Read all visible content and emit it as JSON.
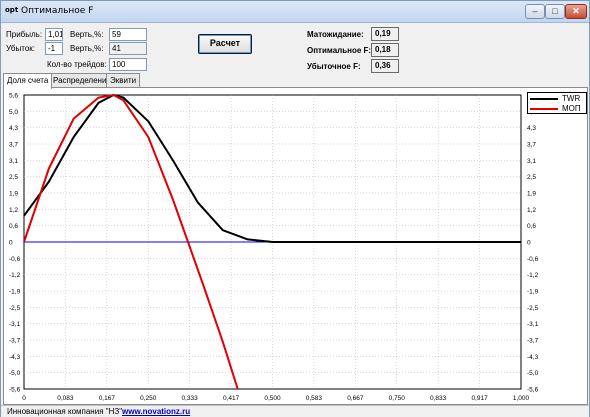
{
  "window": {
    "title": "Оптимальное F",
    "app_icon": "opt"
  },
  "inputs": {
    "profit_label": "Прибыль:",
    "profit_value": "1,01",
    "loss_label": "Убыток:",
    "loss_value": "-1",
    "prob1_label": "Верть,%:",
    "prob1_value": "59",
    "prob2_label": "Верть,%:",
    "prob2_value": "41",
    "trades_label": "Кол-во трейдов:",
    "trades_value": "100"
  },
  "calc_button": "Расчет",
  "results": {
    "expectation_label": "Матожидание:",
    "expectation_value": "0,19",
    "optimal_label": "Оптимальное F:",
    "optimal_value": "0,18",
    "losing_label": "Убыточное F:",
    "losing_value": "0,36"
  },
  "tabs": [
    "Доля счета",
    "Распределение",
    "Эквити"
  ],
  "status": {
    "company": "Инновационная компания \"НЗ\":",
    "link": "www.novationz.ru"
  },
  "chart_data": {
    "type": "line",
    "xlim": [
      0,
      1
    ],
    "ylim": [
      -5.6,
      5.6
    ],
    "x_ticks": [
      "0",
      "0,083",
      "0,167",
      "0,250",
      "0,333",
      "0,417",
      "0,500",
      "0,583",
      "0,667",
      "0,750",
      "0,833",
      "0,917",
      "1,000"
    ],
    "y_ticks": [
      "5,6",
      "5,0",
      "4,3",
      "3,7",
      "3,1",
      "2,5",
      "1,9",
      "1,2",
      "0,6",
      "0",
      "-0,6",
      "-1,2",
      "-1,9",
      "-2,5",
      "-3,1",
      "-3,7",
      "-4,3",
      "-5,0",
      "-5,6"
    ],
    "legend_position": "top-right",
    "grid": true,
    "series": [
      {
        "name": "TWR",
        "color": "#000000",
        "x": [
          0,
          0.05,
          0.1,
          0.15,
          0.18,
          0.2,
          0.25,
          0.3,
          0.35,
          0.4,
          0.45,
          0.5,
          0.6,
          0.8,
          1.0
        ],
        "y": [
          1.0,
          2.3,
          4.0,
          5.3,
          5.6,
          5.5,
          4.6,
          3.1,
          1.5,
          0.45,
          0.1,
          0.0,
          0.0,
          0.0,
          0.0
        ]
      },
      {
        "name": "МОП",
        "color": "#e00000",
        "x": [
          0,
          0.05,
          0.1,
          0.15,
          0.18,
          0.2,
          0.25,
          0.3,
          0.33,
          0.36,
          0.4,
          0.43
        ],
        "y": [
          0.0,
          2.8,
          4.7,
          5.5,
          5.6,
          5.4,
          4.0,
          1.6,
          0.0,
          -1.6,
          -3.8,
          -5.6
        ]
      },
      {
        "name": "",
        "color": "#0000ff",
        "x": [
          0,
          0.5
        ],
        "y": [
          0.0,
          0.0
        ]
      }
    ]
  }
}
